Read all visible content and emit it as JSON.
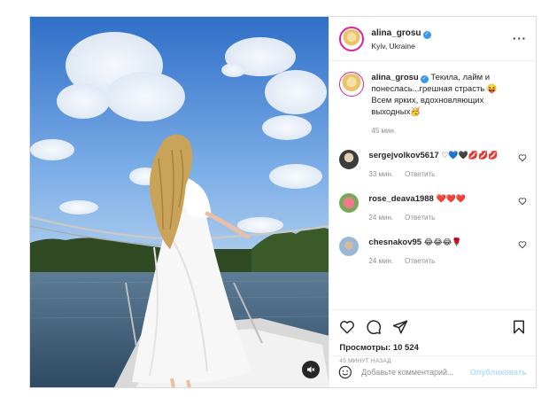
{
  "post": {
    "username": "alina_grosu",
    "location": "Kyiv, Ukraine",
    "more_icon": "more-horizontal-icon",
    "caption_text": "Текила, лайм и понеслась...грешная страсть 😝 Всем ярких, вдохновляющих выходных🥳",
    "caption_time": "45 мин."
  },
  "comments": [
    {
      "username": "sergejvolkov5617",
      "text": "♡💙🖤💋💋💋",
      "time": "33 мин.",
      "reply": "Ответить"
    },
    {
      "username": "rose_deava1988",
      "text": "❤️❤️❤️",
      "time": "24 мин.",
      "reply": "Ответить"
    },
    {
      "username": "chesnakov95",
      "text": "😂😂😂🌹",
      "time": "24 мин.",
      "reply": "Ответить"
    }
  ],
  "actions": {
    "views": "Просмотры: 10 524",
    "posted_ago": "45 МИНУТ НАЗАД"
  },
  "add_comment": {
    "placeholder": "Добавьте комментарий...",
    "publish": "Опубликовать"
  },
  "colors": {
    "link_blue": "#3897f0",
    "publish_disabled": "#b2dffc",
    "border": "#dbdbdb",
    "muted_text": "#8e8e8e"
  }
}
